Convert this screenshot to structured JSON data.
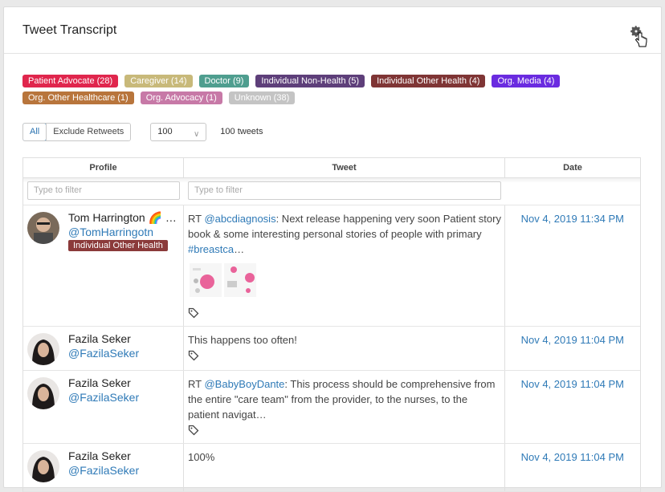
{
  "header": {
    "title": "Tweet Transcript",
    "settings_icon": "gear-icon"
  },
  "badges": {
    "row1": [
      {
        "label": "Patient Advocate (28)",
        "color": "#e0264d"
      },
      {
        "label": "Caregiver (14)",
        "color": "#c8b97a"
      },
      {
        "label": "Doctor (9)",
        "color": "#4f9e8f"
      },
      {
        "label": "Individual Non-Health (5)",
        "color": "#5e3f7a"
      },
      {
        "label": "Individual Other Health (4)",
        "color": "#7f3535"
      },
      {
        "label": "Org. Media (4)",
        "color": "#6a2be0"
      }
    ],
    "row2": [
      {
        "label": "Org. Other Healthcare (1)",
        "color": "#b8753c"
      },
      {
        "label": "Org. Advocacy (1)",
        "color": "#c779a7"
      },
      {
        "label": "Unknown (38)",
        "color": "#c4c4c4"
      }
    ]
  },
  "toolbar": {
    "all_label": "All",
    "exclude_label": "Exclude Retweets",
    "page_size": "100",
    "count_label": "100 tweets"
  },
  "table": {
    "headers": {
      "profile": "Profile",
      "tweet": "Tweet",
      "date": "Date"
    },
    "filter_placeholder": "Type to filter",
    "rows": [
      {
        "name": "Tom Harrington 🌈 …",
        "handle": "@TomHarringotn",
        "badge": "Individual Other Health",
        "rt": "RT ",
        "mention": "@abcdiagnosis",
        "text": ": Next release happening very soon Patient story book & some interesting personal stories of people with primary ",
        "hashtag": "#breastca",
        "ellipsis": "…",
        "date": "Nov 4, 2019 11:34 PM"
      },
      {
        "name": "Fazila Seker",
        "handle": "@FazilaSeker",
        "text": "This happens too often!",
        "date": "Nov 4, 2019 11:04 PM"
      },
      {
        "name": "Fazila Seker",
        "handle": "@FazilaSeker",
        "rt": "RT ",
        "mention": "@BabyBoyDante",
        "text": ": This process should be comprehensive from the entire \"care team\" from the provider, to the nurses, to the patient navigat…",
        "date": "Nov 4, 2019 11:04 PM"
      },
      {
        "name": "Fazila Seker",
        "handle": "@FazilaSeker",
        "text": "100%",
        "date": "Nov 4, 2019 11:04 PM"
      }
    ]
  }
}
